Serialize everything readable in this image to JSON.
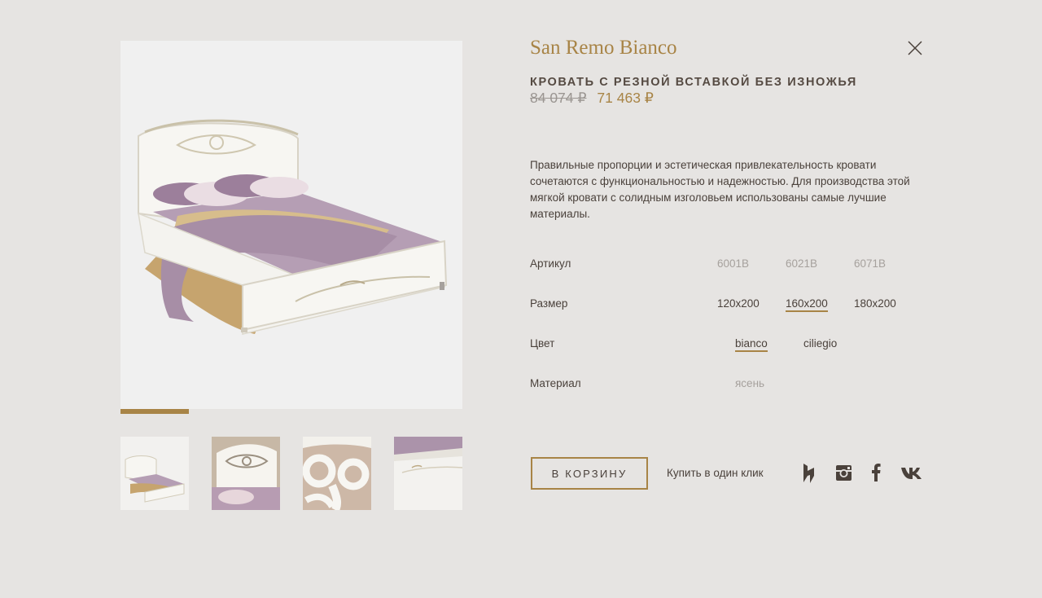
{
  "product": {
    "collection": "San Remo Bianco",
    "type": "КРОВАТЬ С РЕЗНОЙ ВСТАВКОЙ БЕЗ ИЗНОЖЬЯ",
    "old_price": "84 074 ₽",
    "new_price": "71 463 ₽",
    "description": "Правильные пропорции и эстетическая привлекательность кровати сочетаются с функциональностью и надежностью. Для производства этой мягкой кровати с солидным изголовьем использованы самые лучшие материалы."
  },
  "gallery": {
    "progress": 0.2,
    "thumbnails": [
      "bed-full-view",
      "headboard-carving",
      "carving-closeup",
      "footboard-detail"
    ]
  },
  "specs": {
    "article": {
      "label": "Артикул",
      "values": [
        "6001B",
        "6021B",
        "6071B"
      ]
    },
    "size": {
      "label": "Размер",
      "values": [
        "120х200",
        "160х200",
        "180х200"
      ],
      "selected": "160х200"
    },
    "color": {
      "label": "Цвет",
      "values": [
        "bianco",
        "ciliegio"
      ],
      "selected": "bianco"
    },
    "material": {
      "label": "Материал",
      "values": [
        "ясень"
      ]
    }
  },
  "actions": {
    "cart": "В КОРЗИНУ",
    "one_click": "Купить в один клик"
  },
  "social": [
    "houzz-icon",
    "instagram-icon",
    "facebook-icon",
    "vk-icon"
  ],
  "colors": {
    "accent": "#a88446",
    "background": "#e6e4e2",
    "text": "#4a413b",
    "muted": "#a6a19d"
  }
}
